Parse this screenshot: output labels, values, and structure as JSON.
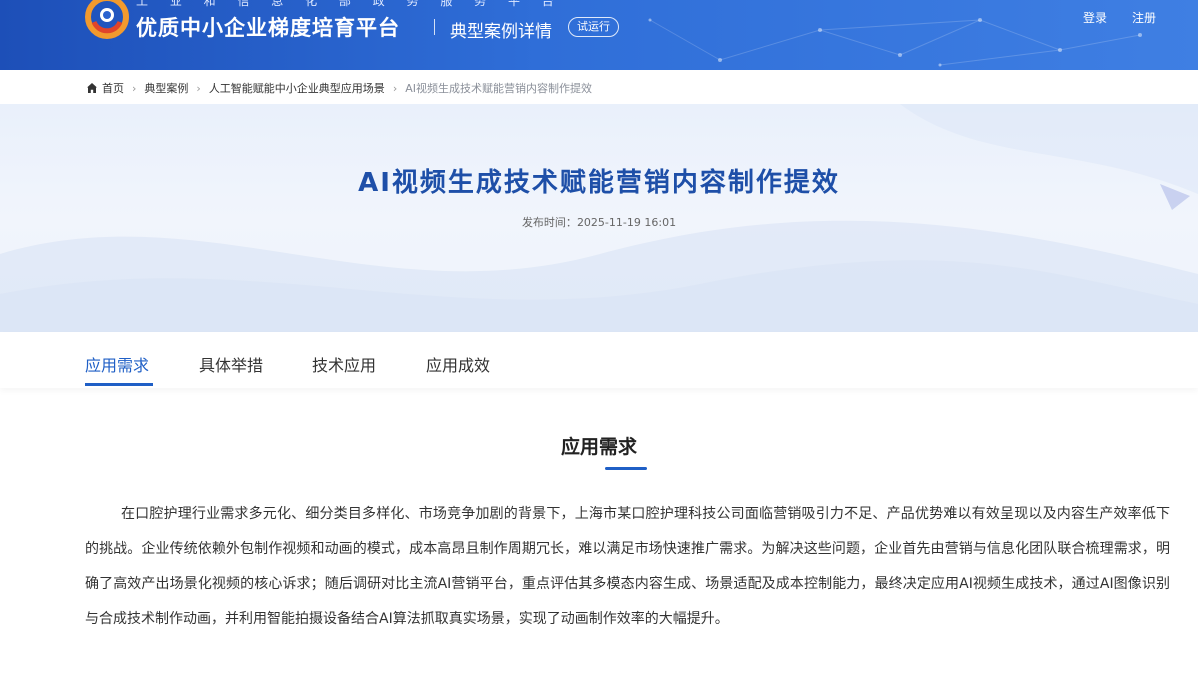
{
  "header": {
    "supertitle": "工 业 和 信 息 化 部 政 务 服 务 平 台",
    "site_title": "优质中小企业梯度培育平台",
    "page_type": "典型案例详情",
    "trial_badge": "试运行",
    "login": "登录",
    "register": "注册",
    "brand_color": "#2a62cf"
  },
  "breadcrumb": {
    "items": [
      "首页",
      "典型案例",
      "人工智能赋能中小企业典型应用场景"
    ],
    "current": "AI视频生成技术赋能营销内容制作提效"
  },
  "banner": {
    "title": "AI视频生成技术赋能营销内容制作提效",
    "publish_label": "发布时间：",
    "publish_time": "2025-11-19 16:01"
  },
  "tabs": [
    {
      "label": "应用需求",
      "active": true
    },
    {
      "label": "具体举措",
      "active": false
    },
    {
      "label": "技术应用",
      "active": false
    },
    {
      "label": "应用成效",
      "active": false
    }
  ],
  "section": {
    "heading": "应用需求",
    "body": "在口腔护理行业需求多元化、细分类目多样化、市场竞争加剧的背景下，上海市某口腔护理科技公司面临营销吸引力不足、产品优势难以有效呈现以及内容生产效率低下的挑战。企业传统依赖外包制作视频和动画的模式，成本高昂且制作周期冗长，难以满足市场快速推广需求。为解决这些问题，企业首先由营销与信息化团队联合梳理需求，明确了高效产出场景化视频的核心诉求；随后调研对比主流AI营销平台，重点评估其多模态内容生成、场景适配及成本控制能力，最终决定应用AI视频生成技术，通过AI图像识别与合成技术制作动画，并利用智能拍摄设备结合AI算法抓取真实场景，实现了动画制作效率的大幅提升。"
  },
  "colors": {
    "accent": "#1f5fc6",
    "title_blue": "#1e4fa8"
  }
}
